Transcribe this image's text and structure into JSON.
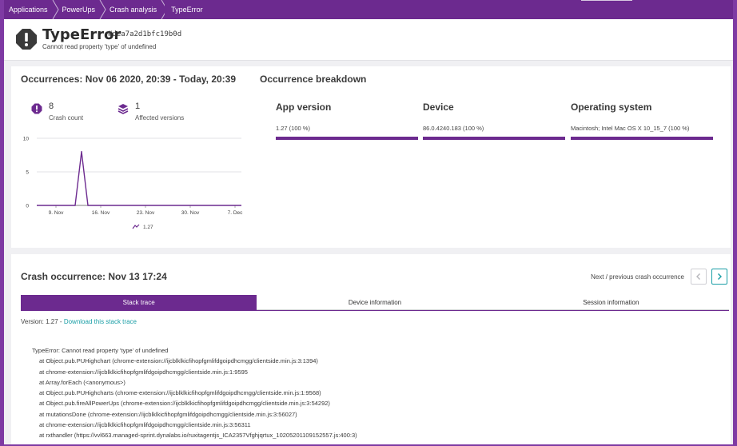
{
  "breadcrumb": [
    {
      "label": "Applications"
    },
    {
      "label": "PowerUps"
    },
    {
      "label": "Crash analysis"
    },
    {
      "label": "TypeError"
    }
  ],
  "header": {
    "title": "TypeError",
    "hash": "#dea7a2d1bfc19b0d",
    "subtitle": "Cannot read property 'type' of undefined",
    "icon": "exclamation-octagon-icon"
  },
  "occurrences": {
    "title": "Occurrences: Nov 06 2020, 20:39 - Today, 20:39",
    "crash_count": {
      "value": "8",
      "label": "Crash count",
      "icon": "crash-alert-icon"
    },
    "affected_versions": {
      "value": "1",
      "label": "Affected versions",
      "icon": "layers-stack-icon"
    }
  },
  "chart_data": {
    "type": "line",
    "x": [
      "Nov 06",
      "Nov 07",
      "Nov 08",
      "Nov 09",
      "Nov 10",
      "Nov 11",
      "Nov 12",
      "Nov 13",
      "Nov 14",
      "Nov 15",
      "Nov 16",
      "Nov 17",
      "Nov 18",
      "Nov 19",
      "Nov 20",
      "Nov 21",
      "Nov 22",
      "Nov 23",
      "Nov 24",
      "Nov 25",
      "Nov 26",
      "Nov 27",
      "Nov 28",
      "Nov 29",
      "Nov 30",
      "Dec 01",
      "Dec 02",
      "Dec 03",
      "Dec 04",
      "Dec 05",
      "Dec 06",
      "Dec 07",
      "Dec 08"
    ],
    "series": [
      {
        "name": "1.27",
        "values": [
          0,
          0,
          0,
          0,
          0,
          0,
          0,
          8,
          0,
          0,
          0,
          0,
          0,
          0,
          0,
          0,
          0,
          0,
          0,
          0,
          0,
          0,
          0,
          0,
          0,
          0,
          0,
          0,
          0,
          0,
          0,
          0,
          0
        ]
      }
    ],
    "tick_labels": [
      "9. Nov",
      "16. Nov",
      "23. Nov",
      "30. Nov",
      "7. Dec"
    ],
    "y_ticks": [
      "0",
      "5",
      "10"
    ],
    "ylim": [
      0,
      10
    ],
    "grid": true,
    "legend": "bottom",
    "color": "#6c2a8f"
  },
  "breakdown": {
    "title": "Occurrence breakdown",
    "columns": [
      {
        "heading": "App version",
        "value": "1.27 (100 %)",
        "share": 1.0
      },
      {
        "heading": "Device",
        "value": "86.0.4240.183 (100 %)",
        "share": 1.0
      },
      {
        "heading": "Operating system",
        "value": "Macintosh; Intel Mac OS X 10_15_7 (100 %)",
        "share": 1.0
      }
    ]
  },
  "crash": {
    "title": "Crash occurrence: Nov 13 17:24",
    "nav_label": "Next / previous crash occurrence",
    "prev_icon": "chevron-left-icon",
    "next_icon": "chevron-right-icon",
    "tabs": [
      {
        "label": "Stack trace",
        "active": true
      },
      {
        "label": "Device information",
        "active": false
      },
      {
        "label": "Session information",
        "active": false
      }
    ],
    "version_prefix": "Version: 1.27 - ",
    "download_link": "Download this stack trace",
    "trace_lines": [
      "TypeError: Cannot read property 'type' of undefined",
      "at Object.pub.PUHighchart (chrome-extension://ijcblklkicfihopfgmlifdgoipdhcmgg/clientside.min.js:3:1394)",
      "at chrome-extension://ijcblklkicfihopfgmlifdgoipdhcmgg/clientside.min.js:1:9595",
      "at Array.forEach (<anonymous>)",
      "at Object.pub.PUHighcharts (chrome-extension://ijcblklkicfihopfgmlifdgoipdhcmgg/clientside.min.js:1:9568)",
      "at Object.pub.fireAllPowerUps (chrome-extension://ijcblklkicfihopfgmlifdgoipdhcmgg/clientside.min.js:3:54292)",
      "at mutationsDone (chrome-extension://ijcblklkicfihopfgmlifdgoipdhcmgg/clientside.min.js:3:56027)",
      "at chrome-extension://ijcblklkicfihopfgmlifdgoipdhcmgg/clientside.min.js:3:56311",
      "at rxthandler (https://vvl663.managed-sprint.dynalabs.io/ruxitagentjs_ICA2357Vfghjqrtux_10205201109152557.js:400:3)"
    ]
  }
}
